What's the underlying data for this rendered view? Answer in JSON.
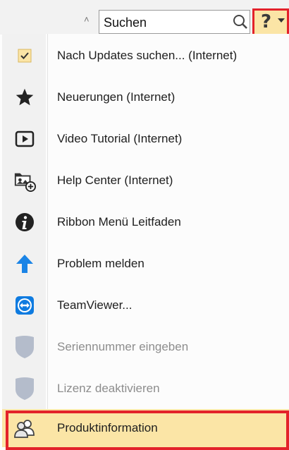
{
  "search": {
    "placeholder": "Suchen",
    "value": ""
  },
  "help_button": {
    "label": "?"
  },
  "menu": {
    "items": [
      {
        "label": "Nach Updates suchen... (Internet)",
        "icon": "checkbox-checked-icon",
        "enabled": true
      },
      {
        "label": "Neuerungen (Internet)",
        "icon": "star-icon",
        "enabled": true
      },
      {
        "label": "Video Tutorial (Internet)",
        "icon": "video-play-icon",
        "enabled": true
      },
      {
        "label": "Help Center (Internet)",
        "icon": "help-center-icon",
        "enabled": true
      },
      {
        "label": "Ribbon Menü Leitfaden",
        "icon": "info-icon",
        "enabled": true
      },
      {
        "label": "Problem melden",
        "icon": "arrow-up-icon",
        "enabled": true
      },
      {
        "label": "TeamViewer...",
        "icon": "teamviewer-icon",
        "enabled": true
      },
      {
        "label": "Seriennummer eingeben",
        "icon": "shield-icon",
        "enabled": false
      },
      {
        "label": "Lizenz deaktivieren",
        "icon": "shield-icon",
        "enabled": false
      },
      {
        "label": "Produktinformation",
        "icon": "users-icon",
        "enabled": true,
        "highlighted": true
      }
    ]
  },
  "colors": {
    "highlight": "#fbe5a6",
    "highlight_border": "#e3222a",
    "accent_blue": "#1a84e6"
  }
}
